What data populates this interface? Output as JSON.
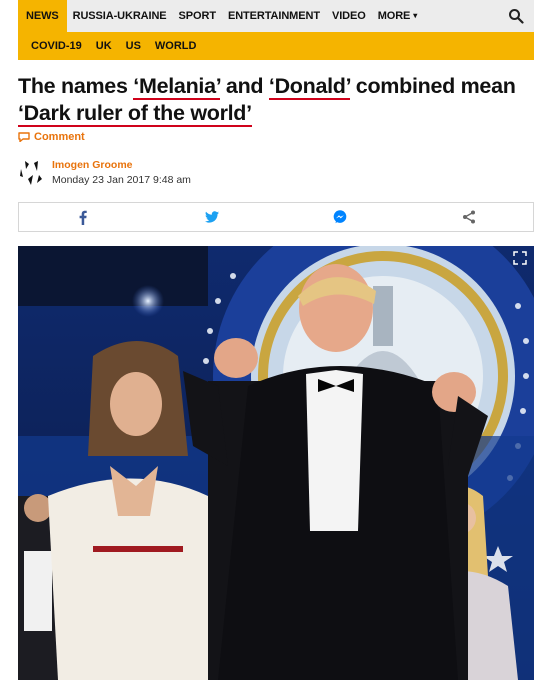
{
  "nav": {
    "items": [
      "NEWS",
      "RUSSIA-UKRAINE",
      "SPORT",
      "ENTERTAINMENT",
      "VIDEO"
    ],
    "more": "MORE",
    "active": "NEWS"
  },
  "subnav": {
    "items": [
      "COVID-19",
      "UK",
      "US",
      "WORLD"
    ]
  },
  "article": {
    "headline_pre": "The names ",
    "headline_name1": "‘Melania’",
    "headline_mid": " and ",
    "headline_name2": "‘Donald’",
    "headline_mid2": " combined mean ",
    "headline_name3": "‘Dark ruler of the world’",
    "comment_label": "Comment",
    "author": "Imogen Groome",
    "date": "Monday 23 Jan 2017 9:48 am"
  },
  "colors": {
    "accent": "#f5b400",
    "link": "#e8730c",
    "underline": "#d0021b"
  },
  "icons": [
    "search-icon",
    "comment-icon",
    "facebook-icon",
    "twitter-icon",
    "messenger-icon",
    "share-icon",
    "expand-icon"
  ]
}
